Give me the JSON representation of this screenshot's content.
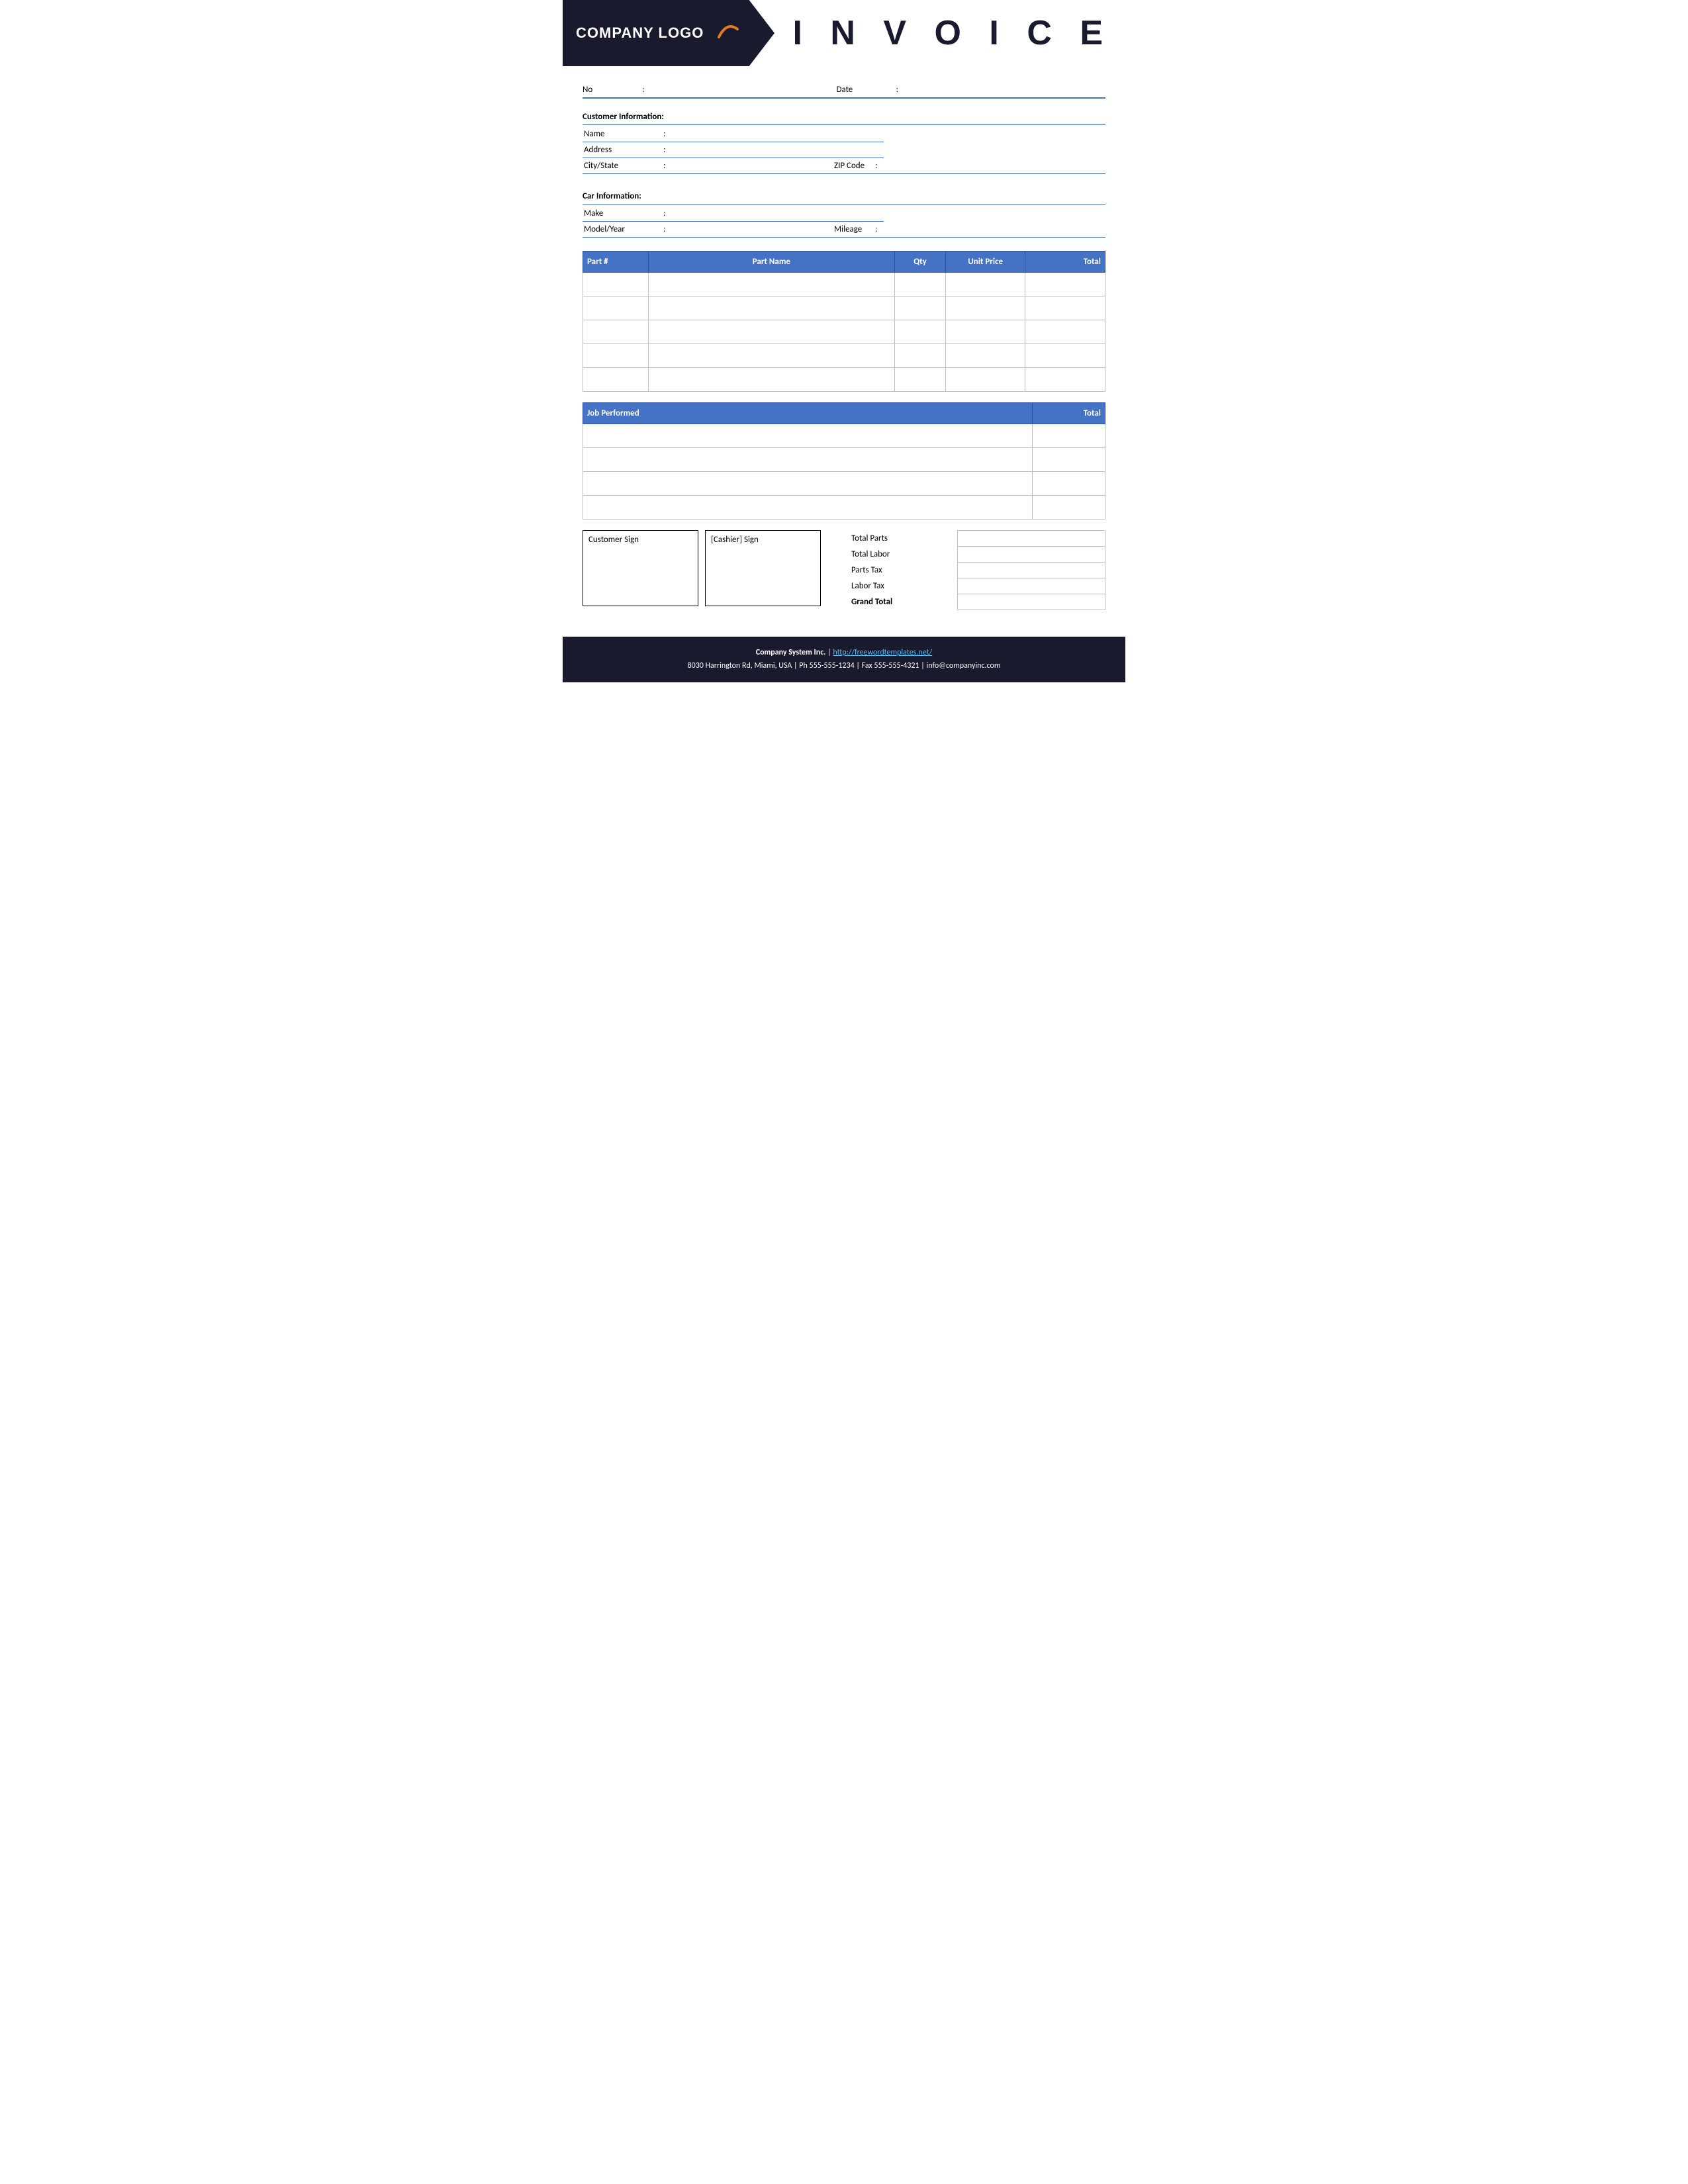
{
  "header": {
    "logo_text": "COMPANY LOGO",
    "invoice_title": "I N V O I C E"
  },
  "form": {
    "no_label": "No",
    "date_label": "Date",
    "colon": ":"
  },
  "customer_info": {
    "section_title": "Customer Information:",
    "name_label": "Name",
    "address_label": "Address",
    "city_state_label": "City/State",
    "zip_code_label": "ZIP Code"
  },
  "car_info": {
    "section_title": "Car Information:",
    "make_label": "Make",
    "model_year_label": "Model/Year",
    "mileage_label": "Mileage"
  },
  "parts_table": {
    "headers": [
      "Part #",
      "Part Name",
      "Qty",
      "Unit Price",
      "Total"
    ],
    "rows": [
      {
        "part_num": "",
        "part_name": "",
        "qty": "",
        "unit_price": "",
        "total": ""
      },
      {
        "part_num": "",
        "part_name": "",
        "qty": "",
        "unit_price": "",
        "total": ""
      },
      {
        "part_num": "",
        "part_name": "",
        "qty": "",
        "unit_price": "",
        "total": ""
      },
      {
        "part_num": "",
        "part_name": "",
        "qty": "",
        "unit_price": "",
        "total": ""
      },
      {
        "part_num": "",
        "part_name": "",
        "qty": "",
        "unit_price": "",
        "total": ""
      }
    ]
  },
  "job_table": {
    "headers": [
      "Job Performed",
      "Total"
    ],
    "rows": [
      {
        "job": "",
        "total": ""
      },
      {
        "job": "",
        "total": ""
      },
      {
        "job": "",
        "total": ""
      },
      {
        "job": "",
        "total": ""
      }
    ]
  },
  "signatures": {
    "customer_sign": "Customer Sign",
    "cashier_sign": "[Cashier] Sign"
  },
  "totals": {
    "total_parts_label": "Total Parts",
    "total_labor_label": "Total Labor",
    "parts_tax_label": "Parts Tax",
    "labor_tax_label": "Labor Tax",
    "grand_total_label": "Grand Total"
  },
  "footer": {
    "company_name": "Company System Inc.",
    "separator": "|",
    "website": "http://freewordtemplates.net/",
    "address": "8030 Harrington Rd, Miami, USA | Ph 555-555-1234 | Fax 555-555-4321 | info@companyinc.com"
  },
  "colors": {
    "header_bg": "#1a1a2e",
    "table_header": "#4472c4",
    "accent": "#e07b20"
  }
}
